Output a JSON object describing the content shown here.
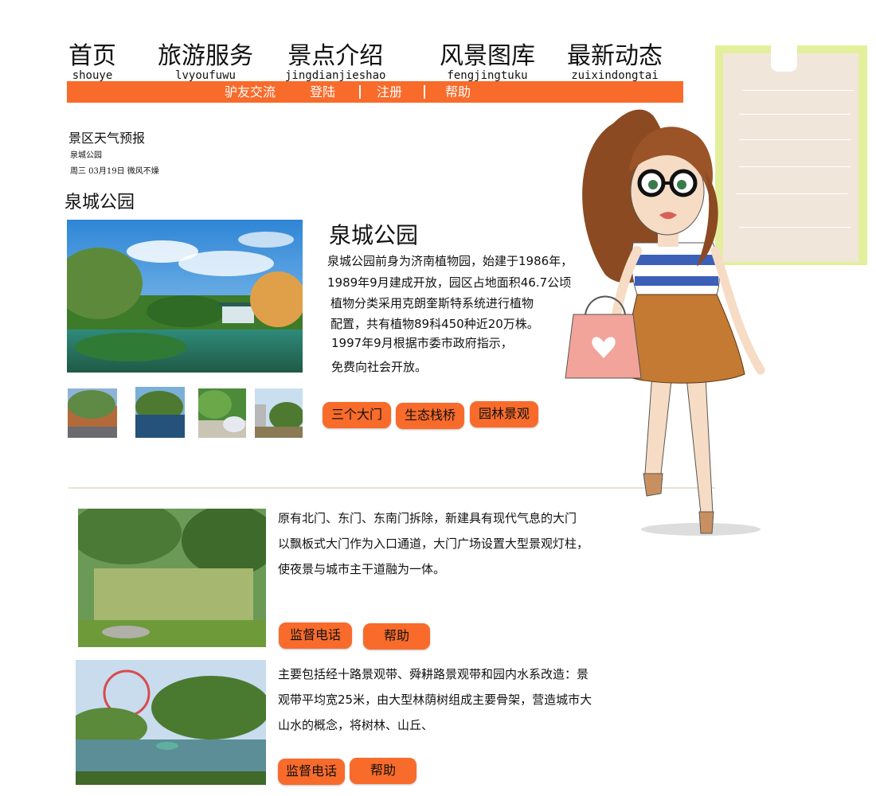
{
  "nav": {
    "items": [
      {
        "cn": "首页",
        "py": "shouye"
      },
      {
        "cn": "旅游服务",
        "py": "lvyoufuwu"
      },
      {
        "cn": "景点介绍",
        "py": "jingdianjieshao"
      },
      {
        "cn": "风景图库",
        "py": "fengjingtuku"
      },
      {
        "cn": "最新动态",
        "py": "zuixindongtai"
      }
    ],
    "sub": [
      "驴友交流",
      "登陆",
      "注册",
      "帮助"
    ]
  },
  "weather": {
    "title": "景区天气预报",
    "place": "泉城公园",
    "line": "周三  03月19日  微风不燥"
  },
  "section_title": "泉城公园",
  "park": {
    "title": "泉城公园",
    "intro": [
      "泉城公园前身为济南植物园，始建于1986年，",
      "1989年9月建成开放，园区占地面积46.7公顷",
      "植物分类采用克朗奎斯特系统进行植物",
      "配置，共有植物89科450种近20万株。",
      "1997年9月根据市委市政府指示，",
      "免费向社会开放。"
    ],
    "tags": [
      "三个大门",
      "生态栈桥",
      "园林景观"
    ]
  },
  "articles": [
    {
      "lines": [
        "原有北门、东门、东南门拆除，新建具有现代气息的大门",
        "以飘板式大门作为入口通道，大门广场设置大型景观灯柱，",
        "使夜景与城市主干道融为一体。"
      ],
      "buttons": [
        "监督电话",
        "帮助"
      ]
    },
    {
      "lines": [
        "主要包括经十路景观带、舜耕路景观带和园内水系改造：景",
        "观带平均宽25米，由大型林荫树组成主要骨架，营造城市大",
        "山水的概念，将树林、山丘、"
      ],
      "buttons": [
        "监督电话",
        "帮助"
      ]
    }
  ],
  "colors": {
    "accent": "#f86b2b",
    "note_frame": "#e4ef9c",
    "note_paper": "#f1e6da"
  }
}
